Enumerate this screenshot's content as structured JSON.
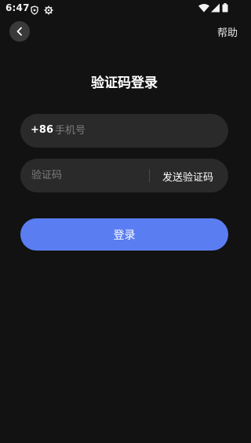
{
  "status_bar": {
    "time": "6:47",
    "left_icons": [
      "shield-icon",
      "settings-gear-icon"
    ],
    "right_icons": [
      "wifi-icon",
      "signal-icon",
      "battery-icon"
    ]
  },
  "header": {
    "back_icon": "chevron-left-icon",
    "help_label": "帮助"
  },
  "main": {
    "title": "验证码登录",
    "phone": {
      "country_code": "+86",
      "placeholder": "手机号",
      "value": ""
    },
    "verification": {
      "placeholder": "验证码",
      "value": "",
      "send_label": "发送验证码"
    },
    "login_label": "登录"
  },
  "colors": {
    "background": "#121212",
    "field_background": "#2a2a2a",
    "accent": "#5a7ef2",
    "placeholder": "#7d7d7d"
  }
}
